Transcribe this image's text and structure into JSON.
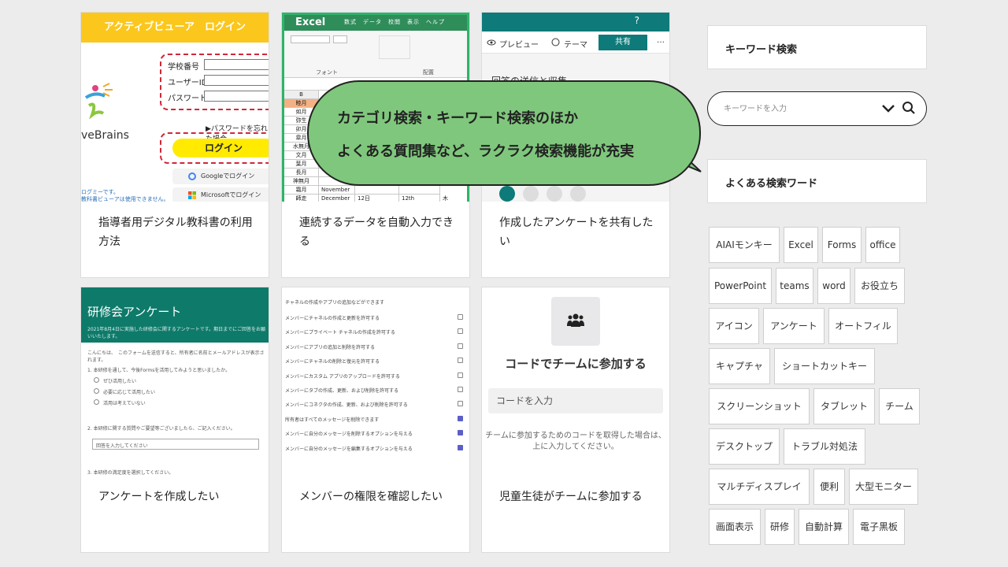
{
  "cards": [
    {
      "caption": "指導者用デジタル教科書の利用方法"
    },
    {
      "caption": "連続するデータを自動入力できる"
    },
    {
      "caption": "作成したアンケートを共有したい"
    },
    {
      "caption": "アンケートを作成したい"
    },
    {
      "caption": "メンバーの権限を確認したい"
    },
    {
      "caption": "児童生徒がチームに参加する"
    }
  ],
  "thumb_login": {
    "header": "アクティブビューア　ログイン",
    "school_no": "学校番号",
    "user_id": "ユーザーID",
    "password": "パスワード",
    "forgot": "▶パスワードを忘れた場合",
    "login_button": "ログイン",
    "google": "Googleでログイン",
    "microsoft": "Microsoftでログイン",
    "brand": "veBrains",
    "note": "ログミーです。\n教科書ビューアは使用できません。"
  },
  "thumb_excel": {
    "app": "Excel",
    "tabs": "数式　データ　校閲　表示　ヘルプ",
    "font_label": "フォント",
    "align_label": "配置",
    "col_b": "B",
    "rows": [
      [
        "睦月",
        "",
        "",
        ""
      ],
      [
        "如月",
        "",
        "",
        ""
      ],
      [
        "弥生",
        "",
        "",
        ""
      ],
      [
        "卯月",
        "",
        "",
        ""
      ],
      [
        "皐月",
        "",
        "",
        ""
      ],
      [
        "水無月",
        "",
        "",
        ""
      ],
      [
        "文月",
        "",
        "",
        ""
      ],
      [
        "葉月",
        "",
        "",
        ""
      ],
      [
        "長月",
        "",
        "",
        ""
      ],
      [
        "神無月",
        "",
        "",
        ""
      ],
      [
        "霜月",
        "November",
        "",
        ""
      ],
      [
        "師走",
        "December",
        "12日",
        "12th"
      ]
    ],
    "last_col": "木"
  },
  "thumb_share": {
    "help": "?",
    "preview": "プレビュー",
    "theme": "テーマ",
    "share": "共有",
    "more": "…",
    "title": "回答の送信と収集"
  },
  "thumb_survey": {
    "title": "研修会アンケート",
    "subtitle": "2021年8月4日に実施した研修会に関するアンケートです。期日までにご回答をお願いいたします。",
    "intro": "こんにちは、　このフォームを送信すると、所有者に名前とメールアドレスが表示されます。",
    "q1": "1. 本研修を通して、今後Formsを活用してみようと思いましたか。",
    "opt1": "ぜひ活用したい",
    "opt2": "必要に応じて活用したい",
    "opt3": "活用は考えていない",
    "q2": "2. 本研修に関する質問やご要望等ございましたら、ご記入ください。",
    "answer_ph": "回答を入力してください",
    "q3": "3. 本研修の満足度を選択してください。"
  },
  "thumb_perm": {
    "heading": "チャネルの作成やアプリの追加などができます",
    "items": [
      {
        "label": "メンバーにチャネルの作成と更新を許可する",
        "checked": false
      },
      {
        "label": "メンバーにプライベート チャネルの作成を許可する",
        "checked": false
      },
      {
        "label": "メンバーにアプリの追加と削除を許可する",
        "checked": false
      },
      {
        "label": "メンバーにチャネルの削除と復元を許可する",
        "checked": false
      },
      {
        "label": "メンバーにカスタム アプリのアップロードを許可する",
        "checked": false
      },
      {
        "label": "メンバーにタブの作成、更新、および削除を許可する",
        "checked": false
      },
      {
        "label": "メンバーにコネクタの作成、更新、および削除を許可する",
        "checked": false
      },
      {
        "label": "所有者はすべてのメッセージを削除できます",
        "checked": true
      },
      {
        "label": "メンバーに自分のメッセージを削除するオプションを与える",
        "checked": true
      },
      {
        "label": "メンバーに自分のメッセージを編集するオプションを与える",
        "checked": true
      }
    ]
  },
  "thumb_join": {
    "title": "コードでチームに参加する",
    "input_placeholder": "コードを入力",
    "help": "チームに参加するためのコードを取得した場合は、\n上に入力してください。"
  },
  "sidebar": {
    "keyword_title": "キーワード検索",
    "search_placeholder": "キーワードを入力",
    "faq_title": "よくある検索ワード",
    "tags": [
      "AIAIモンキー",
      "Excel",
      "Forms",
      "office",
      "PowerPoint",
      "teams",
      "word",
      "お役立ち",
      "アイコン",
      "アンケート",
      "オートフィル",
      "キャプチャ",
      "ショートカットキー",
      "スクリーンショット",
      "タブレット",
      "チーム",
      "デスクトップ",
      "トラブル対処法",
      "マルチディスプレイ",
      "便利",
      "大型モニター",
      "画面表示",
      "研修",
      "自動計算",
      "電子黒板"
    ]
  },
  "bubble": {
    "line1": "カテゴリ検索・キーワード検索のほか",
    "line2": "よくある質問集など、ラクラク検索機能が充実"
  },
  "colors": {
    "teal": "#0e7a7a",
    "excel_green": "#2f8d5a",
    "bubble_green": "#7fc77c",
    "login_yellow": "#fbc71d"
  }
}
